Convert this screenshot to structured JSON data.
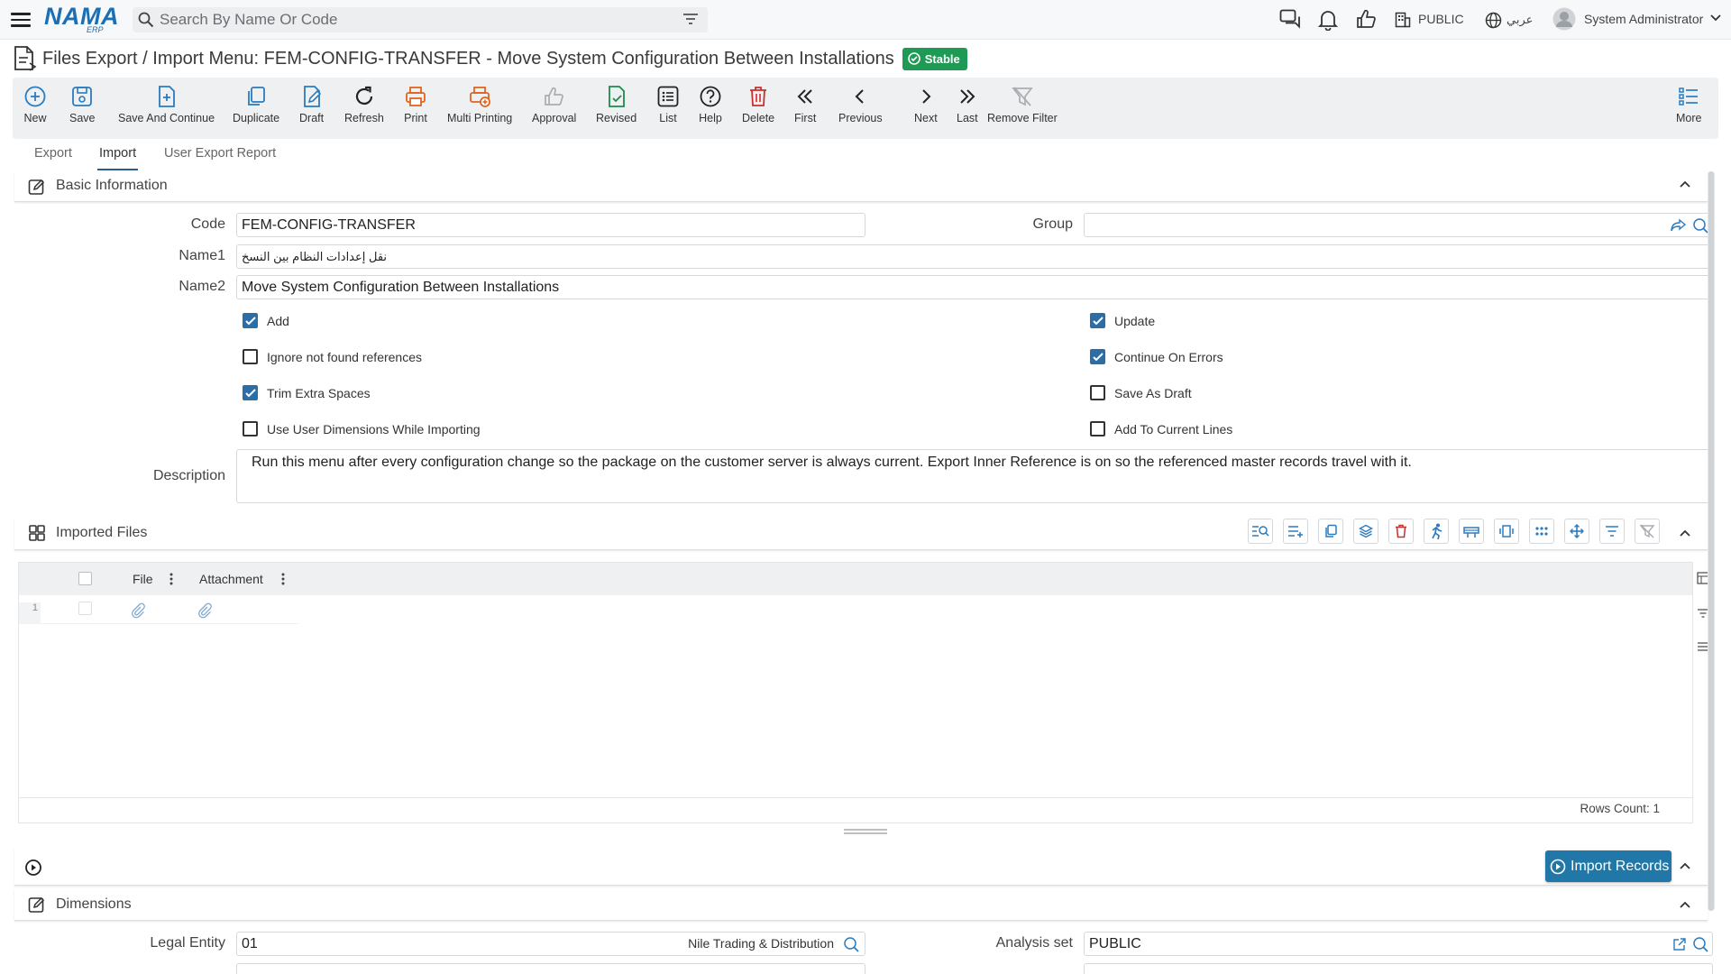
{
  "header": {
    "logo_text": "NAMA",
    "logo_sub": "ERP",
    "search_placeholder": "Search By Name Or Code",
    "public_label": "PUBLIC",
    "language_label": "عربي",
    "user_name": "System Administrator"
  },
  "page": {
    "title": "Files Export / Import Menu: FEM-CONFIG-TRANSFER - Move System Configuration Between Installations",
    "status": "Stable"
  },
  "toolbar": {
    "new": "New",
    "save": "Save",
    "save_continue": "Save And Continue",
    "duplicate": "Duplicate",
    "draft": "Draft",
    "refresh": "Refresh",
    "print": "Print",
    "multi_printing": "Multi Printing",
    "approval": "Approval",
    "revised": "Revised",
    "list": "List",
    "help": "Help",
    "delete": "Delete",
    "first": "First",
    "previous": "Previous",
    "next": "Next",
    "last": "Last",
    "remove_filter": "Remove Filter",
    "more": "More"
  },
  "tabs": [
    "Export",
    "Import",
    "User Export Report"
  ],
  "basic_info": {
    "title": "Basic Information",
    "code_label": "Code",
    "code_value": "FEM-CONFIG-TRANSFER",
    "group_label": "Group",
    "group_value": "",
    "name1_label": "Name1",
    "name1_value": "نقل إعدادات النظام بين النسخ",
    "name2_label": "Name2",
    "name2_value": "Move System Configuration Between Installations",
    "checkboxes": {
      "add": {
        "label": "Add",
        "checked": true
      },
      "update": {
        "label": "Update",
        "checked": true
      },
      "ignore_refs": {
        "label": "Ignore not found references",
        "checked": false
      },
      "continue_errors": {
        "label": "Continue On Errors",
        "checked": true
      },
      "trim_spaces": {
        "label": "Trim Extra Spaces",
        "checked": true
      },
      "save_draft": {
        "label": "Save As Draft",
        "checked": false
      },
      "user_dimensions": {
        "label": "Use User Dimensions While Importing",
        "checked": false
      },
      "add_current_lines": {
        "label": "Add To Current Lines",
        "checked": false
      }
    },
    "description_label": "Description",
    "description_value": "Run this menu after every configuration change so the package on the customer server is always current. Export Inner Reference is on so the referenced master records travel with it."
  },
  "imported_files": {
    "title": "Imported Files",
    "columns": [
      "File",
      "Attachment"
    ],
    "rows": [
      {
        "num": "1"
      }
    ],
    "rows_count": "Rows Count: 1"
  },
  "actions": {
    "import_records": "Import Records"
  },
  "dimensions": {
    "title": "Dimensions",
    "legal_entity_label": "Legal Entity",
    "legal_entity_code": "01",
    "legal_entity_name": "Nile Trading & Distribution",
    "analysis_set_label": "Analysis set",
    "analysis_set_value": "PUBLIC"
  },
  "colors": {
    "brand": "#1b6fb5",
    "accent": "#2178a8",
    "stable_badge": "#1e9a55",
    "checkbox_on": "#2b6ea6",
    "icon_green": "#1e8a4c",
    "icon_orange": "#e06420",
    "icon_red": "#c9302c",
    "icon_blue": "#2a7bbf"
  }
}
